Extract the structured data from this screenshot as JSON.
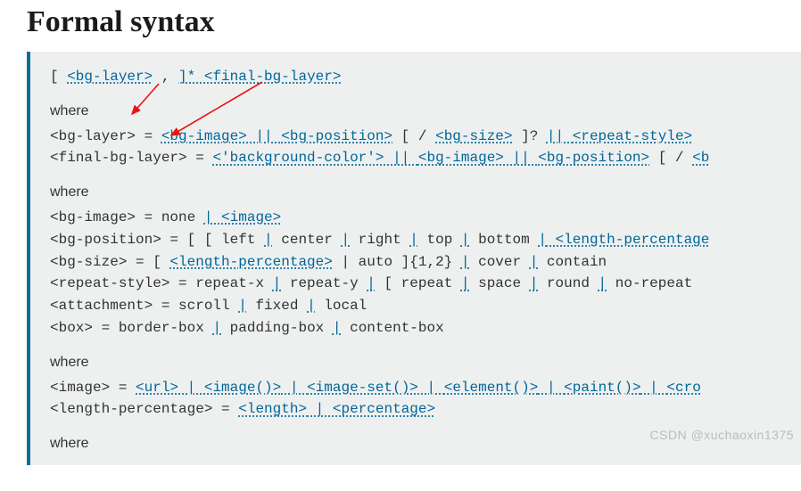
{
  "heading": "Formal syntax",
  "top_line": {
    "bracket_open": "[ ",
    "bg_layer": "<bg-layer>",
    "comma": " , ",
    "closing": "]* ",
    "final_bg_layer": "<final-bg-layer>"
  },
  "group1": {
    "where": "where",
    "l1": {
      "lhs": "<bg-layer> = ",
      "bg_image": "<bg-image>",
      "dbar1": " || ",
      "bg_position": "<bg-position>",
      "mid": " [ / ",
      "bg_size": "<bg-size>",
      "after_size": " ]? ",
      "dbar2": "|| ",
      "repeat_style": "<repeat-style>",
      "tail": " "
    },
    "l2": {
      "lhs": "<final-bg-layer> = ",
      "bgcolor": "<'background-color'>",
      "dbar1": " || ",
      "bg_image": "<bg-image>",
      "dbar2": " || ",
      "bg_position": "<bg-position>",
      "tail": " [ / ",
      "tail_link": "<b"
    }
  },
  "group2": {
    "where": "where",
    "bg_image": {
      "lhs": "<bg-image> = none ",
      "bar": "| ",
      "image": "<image>"
    },
    "bg_position": {
      "lhs": "<bg-position> = [ [ left ",
      "b1": "|",
      "p2": " center ",
      "b2": "|",
      "p3": " right ",
      "b3": "|",
      "p4": " top ",
      "b4": "|",
      "p5": " bottom ",
      "b5": "|",
      "lp": " <length-percentage"
    },
    "bg_size": {
      "lhs": "<bg-size> = [ ",
      "lp": "<length-percentage>",
      "mid": " | auto ]{1,2} ",
      "b1": "|",
      "p2": " cover ",
      "b2": "|",
      "p3": " contain"
    },
    "repeat_style": {
      "lhs": "<repeat-style> = repeat-x ",
      "b1": "|",
      "p2": " repeat-y ",
      "b2": "|",
      "p3": " [ repeat ",
      "b3": "|",
      "p4": " space ",
      "b4": "|",
      "p5": " round ",
      "b5": "|",
      "p6": " no-repeat "
    },
    "attachment": {
      "lhs": "<attachment> = scroll ",
      "b1": "|",
      "p2": " fixed ",
      "b2": "|",
      "p3": " local"
    },
    "box": {
      "lhs": "<box> = border-box ",
      "b1": "|",
      "p2": " padding-box ",
      "b2": "|",
      "p3": " content-box"
    }
  },
  "group3": {
    "where": "where",
    "image": {
      "lhs": "<image> = ",
      "url": "<url>",
      "b1": " | ",
      "img_fn": "<image()>",
      "b2": " | ",
      "img_set": "<image-set()>",
      "b3": " | ",
      "element": "<element()>",
      "b4": " | ",
      "paint": "<paint()>",
      "b5": " | ",
      "cross": "<cro"
    },
    "lp": {
      "lhs": "<length-percentage> = ",
      "length": "<length>",
      "b1": " | ",
      "perc": "<percentage>"
    }
  },
  "group4": {
    "where": "where"
  },
  "watermark": "CSDN @xuchaoxin1375"
}
